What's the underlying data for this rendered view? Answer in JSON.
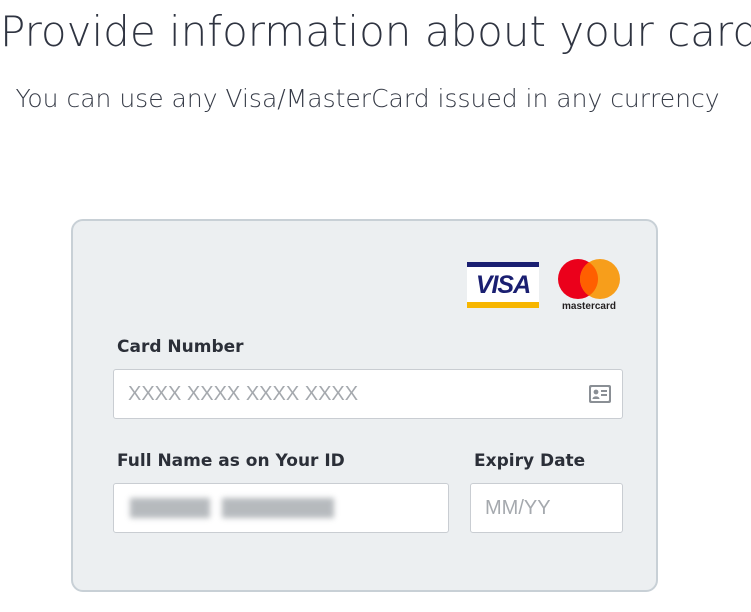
{
  "header": {
    "title": "Provide information about your card",
    "subtitle": "You can use any Visa/MasterCard issued in any currency"
  },
  "logos": {
    "visa": "VISA",
    "mastercard": "mastercard"
  },
  "form": {
    "card_number": {
      "label": "Card Number",
      "placeholder": "XXXX XXXX XXXX XXXX",
      "value": "",
      "icon": "id-card-icon"
    },
    "full_name": {
      "label": "Full Name as on Your ID",
      "value_redacted": true
    },
    "expiry": {
      "label": "Expiry Date",
      "placeholder": "MM/YY",
      "value": ""
    }
  },
  "colors": {
    "panel_bg": "#eceff1",
    "panel_border": "#c8d0d6",
    "visa_blue": "#1a1f71",
    "visa_gold": "#f7b600",
    "mc_red": "#eb001b",
    "mc_orange": "#f79e1b",
    "mc_overlap": "#ff5f00"
  }
}
